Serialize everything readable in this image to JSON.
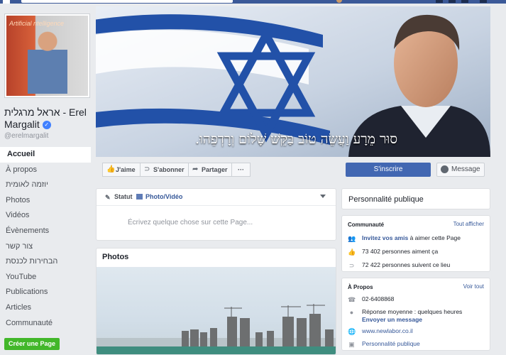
{
  "left": {
    "page_name": "אראל מרגלית - Erel Margalit",
    "handle": "@erelmargalit",
    "profile_photo_text": "Artificial ntelligence",
    "nav": [
      "Accueil",
      "À propos",
      "יוזמה לאומית",
      "Photos",
      "Vidéos",
      "Évènements",
      "צור קשר",
      "הבחירות לכנסת",
      "YouTube",
      "Publications",
      "Articles",
      "Communauté"
    ],
    "create_page": "Créer une Page"
  },
  "cover": {
    "quote": "סוּר מֵרָע וַעֲשֵׂה טוֹב בַּקֵּשׁ שָׁלוֹם וְרָדְפֵהוּ."
  },
  "actions": {
    "like": "J'aime",
    "follow": "S'abonner",
    "share": "Partager",
    "more": "···",
    "subscribe": "S'inscrire",
    "message": "Message"
  },
  "composer": {
    "status_tab": "Statut",
    "photo_tab": "Photo/Vidéo",
    "placeholder": "Écrivez quelque chose sur cette Page..."
  },
  "photos": {
    "title": "Photos"
  },
  "right": {
    "category": "Personnalité publique",
    "community": {
      "title": "Communauté",
      "see_all": "Tout afficher",
      "invite_link": "Invitez vos amis",
      "invite_rest": "à aimer cette Page",
      "likes": "73 402 personnes aiment ça",
      "followers": "72 422 personnes suivent ce lieu"
    },
    "about": {
      "title": "À Propos",
      "see_all": "Voir tout",
      "phone": "02-6408868",
      "response": "Réponse moyenne : quelques heures",
      "send_message": "Envoyer un message",
      "website": "www.newlabor.co.il",
      "category": "Personnalité publique"
    }
  },
  "colors": {
    "facebook_blue": "#3b5998",
    "button_blue": "#4267b2",
    "link_blue": "#365899",
    "create_green": "#42b72a",
    "background": "#e9ebee"
  },
  "icons": [
    "facebook-logo-icon",
    "thumbs-up-icon",
    "rss-icon",
    "share-arrow-icon",
    "chat-bubble-icon",
    "pencil-icon",
    "camera-icon",
    "people-icon",
    "phone-icon",
    "globe-icon",
    "tag-icon"
  ]
}
